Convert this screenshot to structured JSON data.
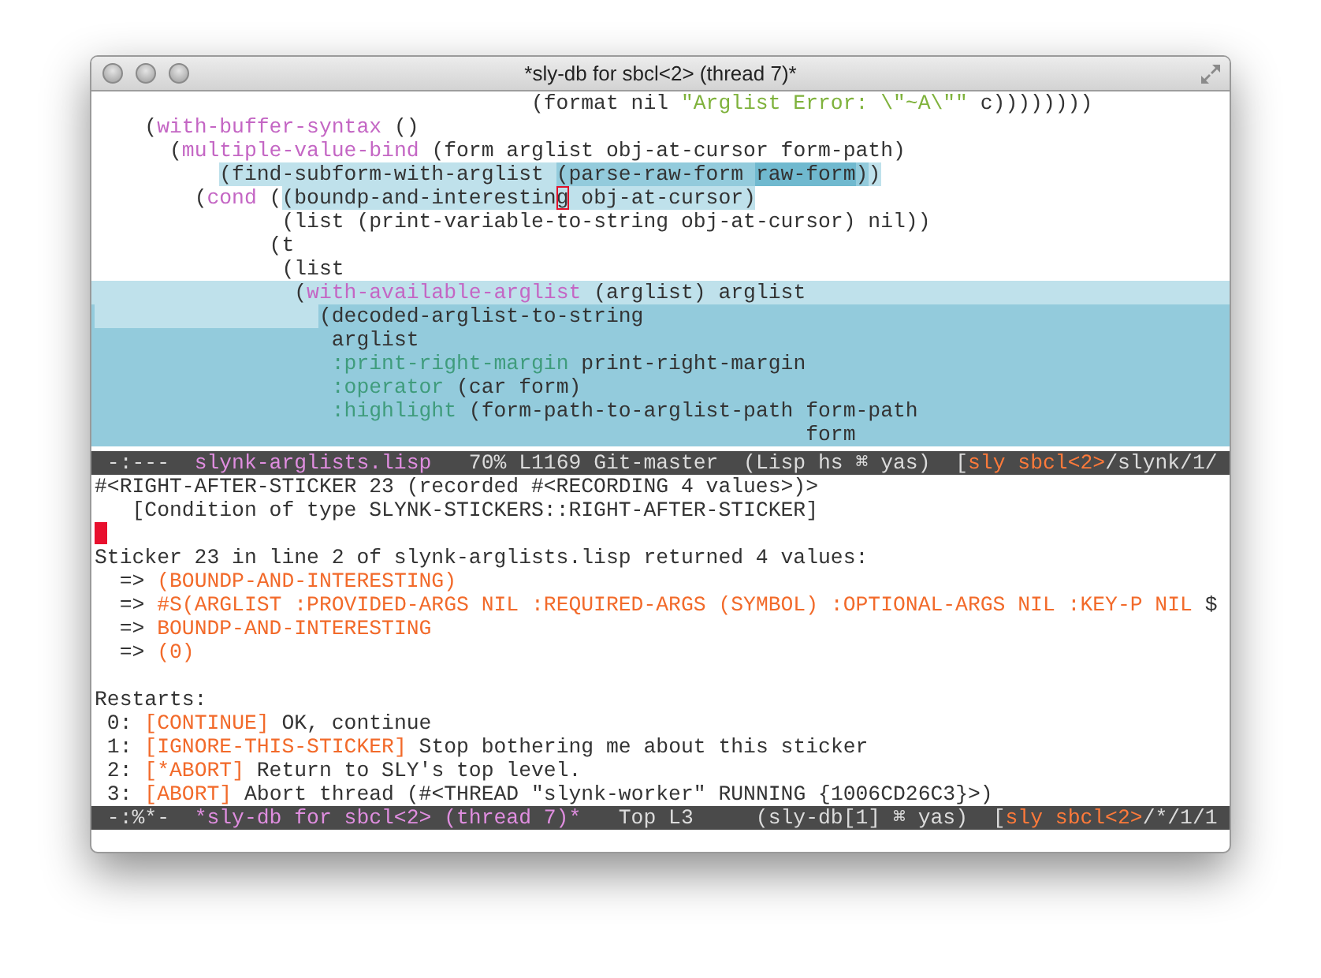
{
  "window": {
    "title": "*sly-db for sbcl<2> (thread 7)*"
  },
  "code_pane": {
    "lines": [
      {
        "segments": [
          {
            "text": "                                   (format nil ",
            "kind": "plain"
          },
          {
            "text": "\"Arglist Error: \\\"~A\\\"\"",
            "kind": "string"
          },
          {
            "text": " c))))))))",
            "kind": "plain"
          }
        ]
      },
      {
        "segments": [
          {
            "text": "    (",
            "kind": "plain"
          },
          {
            "text": "with-buffer-syntax",
            "kind": "builtin"
          },
          {
            "text": " ()",
            "kind": "plain"
          }
        ]
      },
      {
        "segments": [
          {
            "text": "      (",
            "kind": "plain"
          },
          {
            "text": "multiple-value-bind",
            "kind": "builtin"
          },
          {
            "text": " (form arglist obj-at-cursor form-path)",
            "kind": "plain"
          }
        ]
      },
      {
        "segments": [
          {
            "text": "          (find-subform-with-arglist ",
            "kind": "plain",
            "color": "#bfe1eb"
          },
          {
            "text": "(parse-raw-form ",
            "kind": "plain",
            "color": "#93cbdc"
          },
          {
            "text": "raw-form",
            "kind": "plain",
            "color": "#70b9cf"
          },
          {
            "text": ")",
            "kind": "plain",
            "color": "#93cbdc"
          },
          {
            "text": ")",
            "kind": "plain",
            "color": "#bfe1eb"
          }
        ]
      },
      {
        "segments": [
          {
            "text": "        (",
            "kind": "plain"
          },
          {
            "text": "cond",
            "kind": "builtin"
          },
          {
            "text": " (",
            "kind": "plain"
          },
          {
            "text": "(boundp-and-interestin",
            "kind": "plain",
            "color": "#bfe1eb"
          },
          {
            "text": "g",
            "kind": "plain",
            "color": "#bfe1eb",
            "cursor": true
          },
          {
            "text": " obj-at-cursor)",
            "kind": "plain",
            "color": "#bfe1eb"
          }
        ]
      },
      {
        "segments": [
          {
            "text": "               (list (print-variable-to-string obj-at-cursor) nil))",
            "kind": "plain"
          }
        ]
      },
      {
        "segments": [
          {
            "text": "              (t",
            "kind": "plain"
          }
        ]
      },
      {
        "segments": [
          {
            "text": "               (list",
            "kind": "plain"
          }
        ]
      },
      {
        "color": "#bfe1eb",
        "segments": [
          {
            "text": "                (",
            "kind": "plain",
            "color": "#bfe1eb"
          },
          {
            "text": "with-available-arglist",
            "kind": "builtin",
            "color": "#bfe1eb"
          },
          {
            "text": " (arglist) arglist",
            "kind": "plain",
            "color": "#bfe1eb"
          }
        ]
      },
      {
        "color": "#93cbdc",
        "indent": {
          "color": "#bfe1eb"
        },
        "segments": [
          {
            "text": "                  (decoded-arglist-to-string",
            "kind": "plain"
          }
        ]
      },
      {
        "color": "#93cbdc",
        "segments": [
          {
            "text": "                   arglist",
            "kind": "plain"
          }
        ]
      },
      {
        "color": "#93cbdc",
        "segments": [
          {
            "text": "                   :print-right-margin",
            "kind": "keyword"
          },
          {
            "text": " print-right-margin",
            "kind": "plain"
          }
        ]
      },
      {
        "color": "#93cbdc",
        "segments": [
          {
            "text": "                   :operator",
            "kind": "keyword"
          },
          {
            "text": " (car form)",
            "kind": "plain"
          }
        ]
      },
      {
        "color": "#93cbdc",
        "segments": [
          {
            "text": "                   :highlight",
            "kind": "keyword"
          },
          {
            "text": " (form-path-to-arglist-path form-path",
            "kind": "plain"
          }
        ]
      },
      {
        "color": "#93cbdc",
        "segments": [
          {
            "text": "                                                         form",
            "kind": "plain"
          }
        ]
      }
    ]
  },
  "code_mode_line": {
    "segments": [
      {
        "text": " -:---  ",
        "kind": "plain"
      },
      {
        "text": "slynk-arglists.lisp",
        "kind": "buffer"
      },
      {
        "text": "   70% L1169 Git-master  (Lisp hs ⌘ yas)  [",
        "kind": "plain"
      },
      {
        "text": "sly sbcl<2>",
        "kind": "orange"
      },
      {
        "text": "/slynk/1/",
        "kind": "plain"
      }
    ]
  },
  "debugger_pane": {
    "lines": [
      {
        "kind": "text",
        "segments": [
          {
            "text": "#<RIGHT-AFTER-STICKER 23 (recorded #<RECORDING 4 values>)>",
            "kind": "plain"
          }
        ]
      },
      {
        "kind": "text",
        "segments": [
          {
            "text": "   [Condition of type SLYNK-STICKERS::RIGHT-AFTER-STICKER]",
            "kind": "plain"
          }
        ]
      },
      {
        "kind": "cursor"
      },
      {
        "kind": "text",
        "segments": [
          {
            "text": "Sticker 23 in line 2 of slynk-arglists.lisp returned 4 values:",
            "kind": "plain"
          }
        ]
      },
      {
        "kind": "text",
        "segments": [
          {
            "text": "  => ",
            "kind": "plain"
          },
          {
            "text": "(BOUNDP-AND-INTERESTING)",
            "kind": "orange"
          }
        ]
      },
      {
        "kind": "text",
        "segments": [
          {
            "text": "  => ",
            "kind": "plain"
          },
          {
            "text": "#S(ARGLIST :PROVIDED-ARGS NIL :REQUIRED-ARGS (SYMBOL) :OPTIONAL-ARGS NIL :KEY-P NIL",
            "kind": "orange"
          },
          {
            "text": " $",
            "kind": "plain"
          }
        ]
      },
      {
        "kind": "text",
        "segments": [
          {
            "text": "  => ",
            "kind": "plain"
          },
          {
            "text": "BOUNDP-AND-INTERESTING",
            "kind": "orange"
          }
        ]
      },
      {
        "kind": "text",
        "segments": [
          {
            "text": "  => ",
            "kind": "plain"
          },
          {
            "text": "(0)",
            "kind": "orange"
          }
        ]
      },
      {
        "kind": "blank"
      },
      {
        "kind": "text",
        "segments": [
          {
            "text": "Restarts:",
            "kind": "plain"
          }
        ]
      },
      {
        "kind": "text",
        "segments": [
          {
            "text": " 0: ",
            "kind": "plain"
          },
          {
            "text": "[CONTINUE]",
            "kind": "orange"
          },
          {
            "text": " OK, continue",
            "kind": "plain"
          }
        ]
      },
      {
        "kind": "text",
        "segments": [
          {
            "text": " 1: ",
            "kind": "plain"
          },
          {
            "text": "[IGNORE-THIS-STICKER]",
            "kind": "orange"
          },
          {
            "text": " Stop bothering me about this sticker",
            "kind": "plain"
          }
        ]
      },
      {
        "kind": "text",
        "segments": [
          {
            "text": " 2: ",
            "kind": "plain"
          },
          {
            "text": "[*ABORT]",
            "kind": "orange"
          },
          {
            "text": " Return to SLY's top level.",
            "kind": "plain"
          }
        ]
      },
      {
        "kind": "text",
        "segments": [
          {
            "text": " 3: ",
            "kind": "plain"
          },
          {
            "text": "[ABORT]",
            "kind": "orange"
          },
          {
            "text": " Abort thread (#<THREAD \"slynk-worker\" RUNNING {1006CD26C3}>)",
            "kind": "plain"
          }
        ]
      }
    ]
  },
  "debugger_mode_line": {
    "segments": [
      {
        "text": " -:%*-  ",
        "kind": "plain"
      },
      {
        "text": "*sly-db for sbcl<2> (thread 7)*",
        "kind": "buffer"
      },
      {
        "text": "   Top L3     (sly-db[1] ⌘ yas)  [",
        "kind": "plain"
      },
      {
        "text": "sly sbcl<2>",
        "kind": "orange"
      },
      {
        "text": "/*/1/1",
        "kind": "plain"
      }
    ]
  }
}
